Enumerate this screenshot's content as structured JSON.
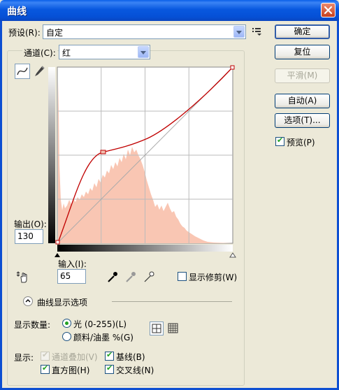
{
  "window": {
    "title": "曲线"
  },
  "preset": {
    "label": "预设(R):",
    "value": "自定"
  },
  "channel": {
    "label": "通道(C):",
    "value": "红"
  },
  "buttons": {
    "ok": "确定",
    "reset": "复位",
    "smooth": "平滑(M)",
    "auto": "自动(A)",
    "options": "选项(T)..."
  },
  "preview": {
    "label": "预览(P)",
    "checked": true
  },
  "output": {
    "label": "输出(O):",
    "value": "130"
  },
  "input": {
    "label": "输入(I):",
    "value": "65"
  },
  "show_clipping": {
    "label": "显示修剪(W)",
    "checked": false
  },
  "curve_display_options": {
    "label": "曲线显示选项"
  },
  "show_amount": {
    "label": "显示数量:",
    "light": "光 (0-255)(L)",
    "pigment": "颜料/油墨 %(G)",
    "selected": "light"
  },
  "show": {
    "label": "显示:",
    "channel_overlays": "通道叠加(V)",
    "baseline": "基线(B)",
    "histogram": "直方图(H)",
    "intersection": "交叉线(N)"
  },
  "colors": {
    "curve": "#c00000",
    "histogram": "#f9c6b3",
    "accent": "#0a5fe8"
  },
  "icons": {
    "close": "close-icon",
    "preset_menu": "preset-menu-icon",
    "curve_tool": "curve-point-tool-icon",
    "pencil": "pencil-icon",
    "hand": "target-adjust-hand-icon",
    "black_eyedropper": "black-point-eyedropper-icon",
    "gray_eyedropper": "gray-point-eyedropper-icon",
    "white_eyedropper": "white-point-eyedropper-icon",
    "expand": "expand-chevron-icon",
    "grid_simple": "grid-4x4-icon",
    "grid_detailed": "grid-10x10-icon"
  }
}
